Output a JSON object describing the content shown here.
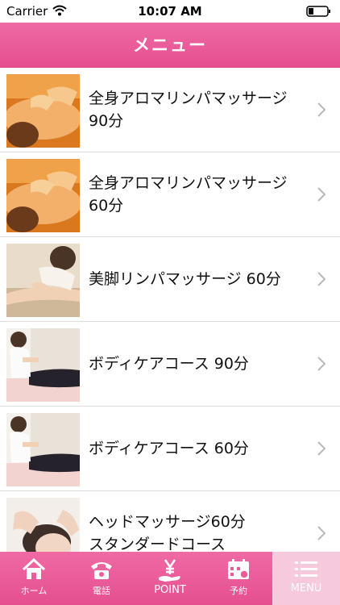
{
  "status_bar": {
    "carrier": "Carrier",
    "time": "10:07 AM"
  },
  "header": {
    "title": "メニュー"
  },
  "menu": {
    "items": [
      {
        "line1": "全身アロマリンパマッサージ",
        "line2": "90分",
        "thumb": "massage-back"
      },
      {
        "line1": "全身アロマリンパマッサージ",
        "line2": "60分",
        "thumb": "massage-back"
      },
      {
        "line1": "美脚リンパマッサージ 60分",
        "line2": "",
        "thumb": "leg-massage"
      },
      {
        "line1": "ボディケアコース 90分",
        "line2": "",
        "thumb": "body-care"
      },
      {
        "line1": "ボディケアコース 60分",
        "line2": "",
        "thumb": "body-care"
      },
      {
        "line1": "ヘッドマッサージ60分",
        "line2": "スタンダードコース",
        "thumb": "head-massage"
      }
    ]
  },
  "tabs": [
    {
      "label": "ホーム",
      "icon": "home-icon"
    },
    {
      "label": "電話",
      "icon": "phone-icon"
    },
    {
      "label": "POINT",
      "icon": "yen-hand-icon"
    },
    {
      "label": "予約",
      "icon": "calendar-icon"
    },
    {
      "label": "MENU",
      "icon": "list-icon",
      "active": true
    }
  ],
  "colors": {
    "accent": "#e85c98",
    "active_tab": "#f6c9dd"
  }
}
